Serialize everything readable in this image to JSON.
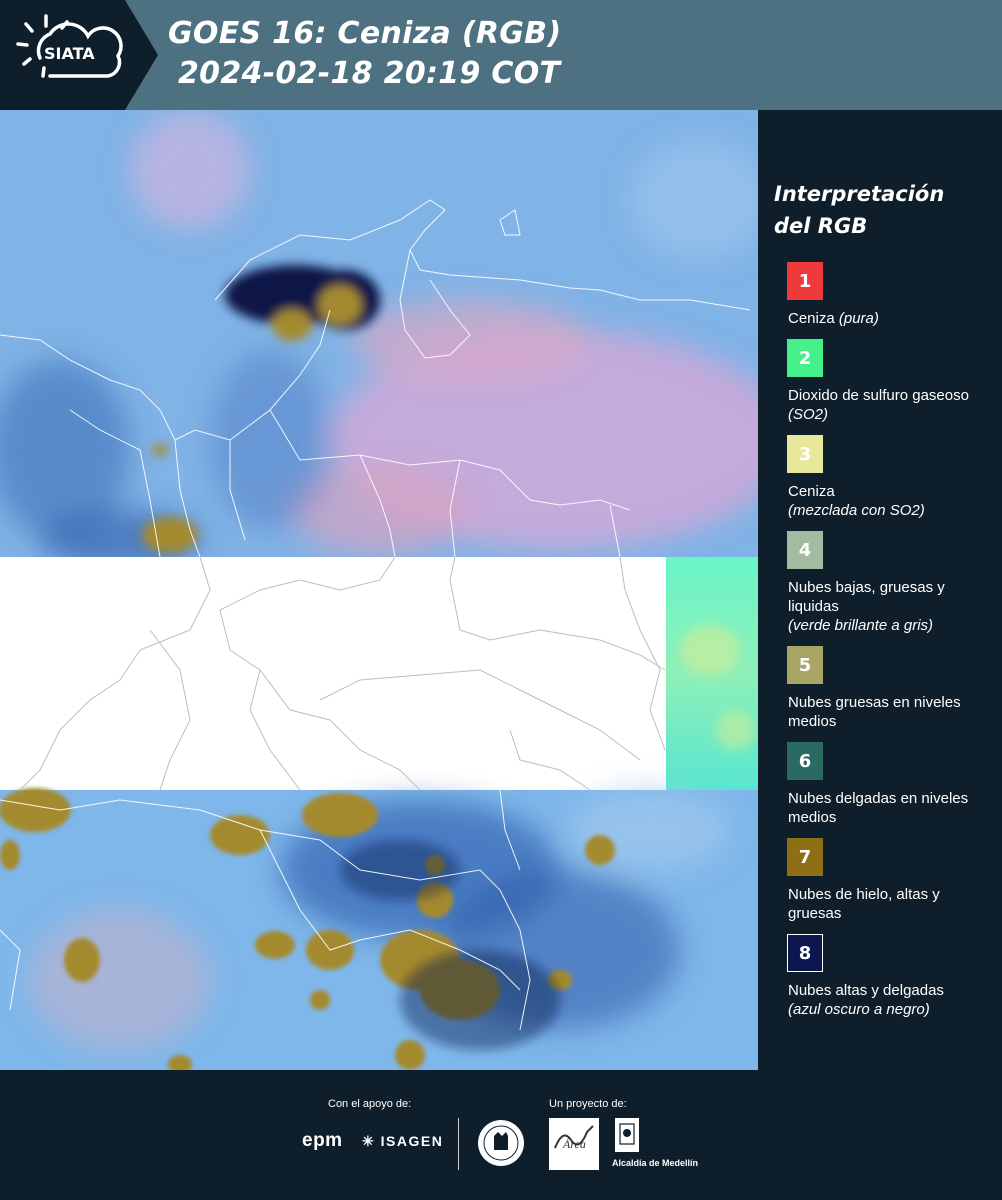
{
  "header": {
    "logo_text": "SIATA",
    "title_line1": "GOES 16: Ceniza (RGB)",
    "title_line2": "2024-02-18 20:19 COT"
  },
  "legend": {
    "title_line1": "Interpretación",
    "title_line2": "del RGB",
    "items": [
      {
        "number": "1",
        "color": "#f0393b",
        "text_color": "#ffffff",
        "label": "Ceniza",
        "note": "(pura)",
        "note_newline": false
      },
      {
        "number": "2",
        "color": "#44f08a",
        "text_color": "#ffffff",
        "label": "Dioxido de sulfuro gaseoso",
        "note": "(SO2)",
        "note_newline": false
      },
      {
        "number": "3",
        "color": "#e8e89a",
        "text_color": "#ffffff",
        "label": "Ceniza",
        "note": "(mezclada con SO2)",
        "note_newline": true
      },
      {
        "number": "4",
        "color": "#a3bba0",
        "text_color": "#ffffff",
        "label": "Nubes bajas, gruesas y liquidas",
        "note": "(verde brillante a gris)",
        "note_newline": true
      },
      {
        "number": "5",
        "color": "#a9a566",
        "text_color": "#ffffff",
        "label": "Nubes gruesas en niveles medios",
        "note": "",
        "note_newline": false
      },
      {
        "number": "6",
        "color": "#2b6a60",
        "text_color": "#ffffff",
        "label": "Nubes delgadas en niveles medios",
        "note": "",
        "note_newline": false
      },
      {
        "number": "7",
        "color": "#8e6f14",
        "text_color": "#ffffff",
        "label": "Nubes de hielo, altas y gruesas",
        "note": "",
        "note_newline": false
      },
      {
        "number": "8",
        "color": "#0b174e",
        "text_color": "#ffffff",
        "label": "Nubes altas y delgadas",
        "note": "(azul oscuro a negro)",
        "note_newline": true
      }
    ]
  },
  "footer": {
    "support_label": "Con el apoyo de:",
    "project_label": "Un proyecto de:",
    "sponsor1": "epm",
    "sponsor2": "ISAGEN",
    "partner_area": "Área Metropolitana Valle de Aburrá",
    "partner_alcaldia": "Alcaldía de Medellín"
  },
  "colors": {
    "background": "#0e1f2b",
    "header": "#4d7180",
    "ocean_blue": "#7fb2e8",
    "pink_haze": "#c8a8d6",
    "ice_cloud": "#a48a2e",
    "dark_cloud": "#0b1446",
    "missing_data": "#ffffff",
    "lowcloud_green": "#5ff0c0"
  }
}
